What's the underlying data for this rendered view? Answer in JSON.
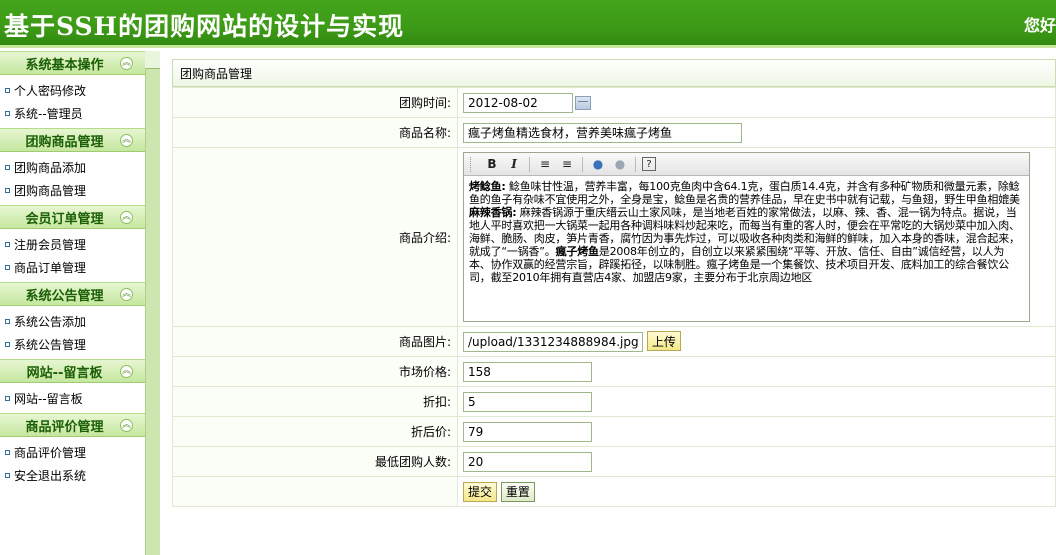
{
  "header": {
    "title": "基于SSH的团购网站的设计与实现",
    "welcome": "您好"
  },
  "sidebar": {
    "groups": [
      {
        "title": "系统基本操作",
        "items": [
          "个人密码修改",
          "系统--管理员"
        ]
      },
      {
        "title": "团购商品管理",
        "items": [
          "团购商品添加",
          "团购商品管理"
        ]
      },
      {
        "title": "会员订单管理",
        "items": [
          "注册会员管理",
          "商品订单管理"
        ]
      },
      {
        "title": "系统公告管理",
        "items": [
          "系统公告添加",
          "系统公告管理"
        ]
      },
      {
        "title": "网站--留言板",
        "items": [
          "网站--留言板"
        ]
      },
      {
        "title": "商品评价管理",
        "items": [
          "商品评价管理",
          "安全退出系统"
        ]
      }
    ],
    "toggle_glyph": "︽"
  },
  "main": {
    "section_title": "团购商品管理",
    "fields": {
      "date_label": "团购时间:",
      "date_value": "2012-08-02",
      "name_label": "商品名称:",
      "name_value": "瘋子烤鱼精选食材，营养美味瘋子烤鱼",
      "intro_label": "商品介绍:",
      "image_label": "商品图片:",
      "image_value": "/upload/1331234888984.jpg",
      "upload_label": "上传",
      "market_price_label": "市场价格:",
      "market_price_value": "158",
      "discount_label": "折扣:",
      "discount_value": "5",
      "discounted_price_label": "折后价:",
      "discounted_price_value": "79",
      "min_buyers_label": "最低团购人数:",
      "min_buyers_value": "20"
    },
    "editor": {
      "toolbar": {
        "bold": "B",
        "italic": "I",
        "ordered_list": "≡",
        "unordered_list": "≡",
        "link": "●",
        "unlink": "●",
        "help": "?"
      },
      "bold1": "烤鲶鱼:",
      "text1": " 鲶鱼味甘性温，营养丰富，每100克鱼肉中含64.1克，蛋白质14.4克，并含有多种矿物质和微量元素，除鲶鱼的鱼子有杂味不宜使用之外，全身是宝，鲶鱼是名贵的营养佳品，早在史书中就有记载，与鱼翅，野生甲鱼相媲美",
      "bold2": "麻辣香锅:",
      "text2": " 麻辣香锅源于重庆缙云山土家风味，是当地老百姓的家常做法，以麻、辣、香、混一锅为特点。据说，当地人平时喜欢把一大锅菜一起用各种调料味料炒起来吃，而每当有重的客人时，便会在平常吃的大锅炒菜中加入肉、海鲜、脆肠、肉皮，笋片青香，腐竹因为事先炸过，可以吸收各种肉类和海鲜的鲜味，加入本身的香味，混合起来，就成了“一锅香”。",
      "bold3": "瘋子烤鱼",
      "text3": "是2008年创立的，自创立以来紧紧围绕“平等、开放、信任、自由”诚信经营，以人为本、协作双赢的经营宗旨，辟蹊拓径，以味制胜。瘋子烤鱼是一个集餐饮、技术项目开发、底料加工的综合餐饮公司，截至2010年拥有直营店4家、加盟店9家，主要分布于北京周边地区"
    },
    "buttons": {
      "submit": "提交",
      "reset": "重置"
    }
  },
  "colors": {
    "header_green": "#3d9a16",
    "sidebar_head": "#c5e79f",
    "group_text": "#1a5e05"
  }
}
